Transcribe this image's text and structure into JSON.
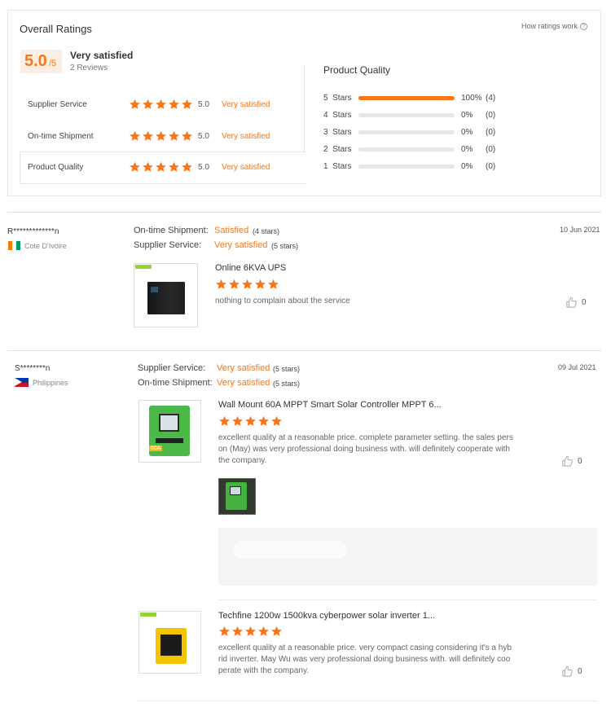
{
  "summary": {
    "title": "Overall Ratings",
    "score": "5.0",
    "score_suffix": "/5",
    "verdict": "Very satisfied",
    "review_count": "2 Reviews",
    "how_ratings_work": "How ratings work",
    "rows": [
      {
        "label": "Supplier Service",
        "value": "5.0",
        "verdict": "Very satisfied",
        "stars": 5
      },
      {
        "label": "On-time Shipment",
        "value": "5.0",
        "verdict": "Very satisfied",
        "stars": 5
      },
      {
        "label": "Product Quality",
        "value": "5.0",
        "verdict": "Very satisfied",
        "stars": 5
      }
    ]
  },
  "quality": {
    "title": "Product Quality",
    "bars": [
      {
        "label": "5  Stars",
        "percent": "100%",
        "count": "(4)",
        "fill": 1.0
      },
      {
        "label": "4  Stars",
        "percent": "0%",
        "count": "(0)",
        "fill": 0
      },
      {
        "label": "3  Stars",
        "percent": "0%",
        "count": "(0)",
        "fill": 0
      },
      {
        "label": "2  Stars",
        "percent": "0%",
        "count": "(0)",
        "fill": 0
      },
      {
        "label": "1  Stars",
        "percent": "0%",
        "count": "(0)",
        "fill": 0
      }
    ]
  },
  "reviews": [
    {
      "reviewer": "R*************n",
      "country": "Cote D'Ivoire",
      "date": "10 Jun 2021",
      "ratings": [
        {
          "label": "On-time Shipment:",
          "verdict": "Satisfied",
          "stars_text": "(4 stars)"
        },
        {
          "label": "Supplier Service:",
          "verdict": "Very satisfied",
          "stars_text": "(5 stars)"
        }
      ],
      "items": [
        {
          "product": "Online 6KVA UPS",
          "stars": 5,
          "comment": "nothing to complain about the service",
          "likes": "0"
        }
      ]
    },
    {
      "reviewer": "S********n",
      "country": "Philippines",
      "date": "09 Jul 2021",
      "ratings": [
        {
          "label": "Supplier Service:",
          "verdict": "Very satisfied",
          "stars_text": "(5 stars)"
        },
        {
          "label": "On-time Shipment:",
          "verdict": "Very satisfied",
          "stars_text": "(5 stars)"
        }
      ],
      "items": [
        {
          "product": "Wall Mount 60A MPPT Smart Solar Controller MPPT 6...",
          "stars": 5,
          "comment_lines": [
            "excellent quality at a reasonable price. complete parameter setting. the sales pers",
            "on (May) was very professional doing business with. will definitely cooperate with",
            "the company."
          ],
          "likes": "0",
          "img_badge": "60A"
        },
        {
          "product": "Techfine 1200w 1500kva cyberpower solar inverter 1...",
          "stars": 5,
          "comment_lines": [
            "excellent quality at a reasonable price. very compact casing considering it's a hyb",
            "rid inverter. May Wu was very professional doing business with. will definitely coo",
            "perate with the company."
          ],
          "likes": "0"
        }
      ]
    }
  ],
  "colors": {
    "accent": "#f7761a",
    "bar_track": "#e8e8e8",
    "border": "#e6e6e6"
  }
}
